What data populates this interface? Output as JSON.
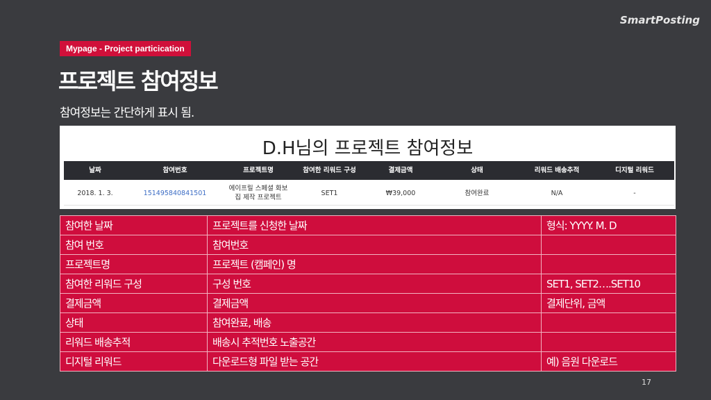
{
  "brand": "SmartPosting",
  "badge": "Mypage - Project particication",
  "title": "프로젝트 참여정보",
  "subtitle": "참여정보는 간단하게 표시 됨.",
  "screenshot": {
    "title": "D.H님의 프로젝트 참여정보",
    "headers": [
      "날짜",
      "참여번호",
      "프로젝트명",
      "참여한 리워드 구성",
      "결제금액",
      "상태",
      "리워드 배송추적",
      "디지털 리워드"
    ],
    "row": [
      "2018. 1. 3.",
      "151495840841501",
      "에이프릴 스페셜 화보집 제작 프로젝트",
      "SET1",
      "₩39,000",
      "참여완료",
      "N/A",
      "-"
    ]
  },
  "fields": [
    {
      "name": "참여한 날짜",
      "desc": "프로젝트를 신청한 날짜",
      "note": "형식: YYYY. M. D"
    },
    {
      "name": "참여 번호",
      "desc": "참여번호",
      "note": ""
    },
    {
      "name": "프로젝트명",
      "desc": "프로젝트 (캠페인) 명",
      "note": ""
    },
    {
      "name": "참여한 리워드 구성",
      "desc": "구성 번호",
      "note": "SET1, SET2….SET10"
    },
    {
      "name": "결제금액",
      "desc": "결제금액",
      "note": "결제단위, 금액"
    },
    {
      "name": "상태",
      "desc": "참여완료, 배송",
      "note": ""
    },
    {
      "name": "리워드 배송추적",
      "desc": "배송시 추적번호 노출공간",
      "note": ""
    },
    {
      "name": "디지털 리워드",
      "desc": "다운로드형 파일 받는 공간",
      "note": "예) 음원 다운로드"
    }
  ],
  "page_number": "17"
}
